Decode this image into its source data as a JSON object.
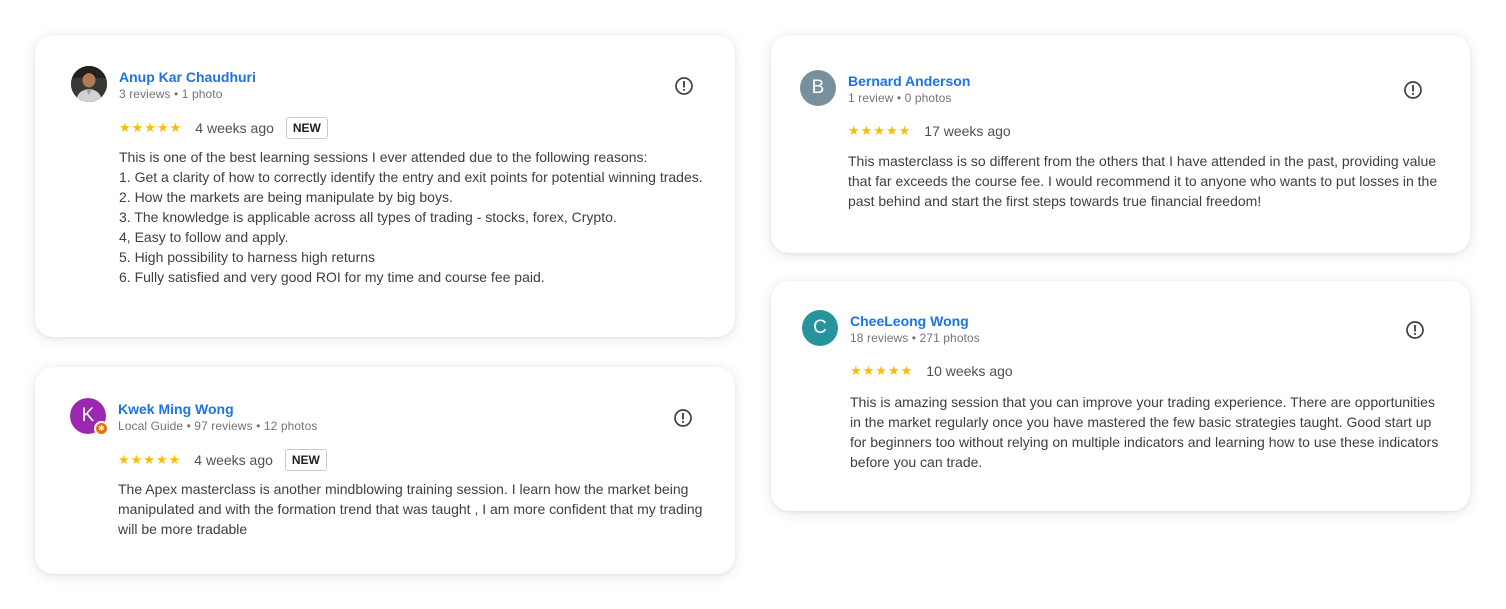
{
  "colors": {
    "name_link": "#1a73e8",
    "star": "#fbbc04",
    "avatar_kwek": "#9c27b0",
    "avatar_bernard": "#78909c",
    "avatar_cheeleong": "#26939d",
    "local_guide_badge": "#e37400"
  },
  "reviews": [
    {
      "author": "Anup Kar Chaudhuri",
      "meta": "3 reviews • 1 photo",
      "avatar_icon": "user-photo",
      "stars": "★★★★★",
      "rating": 5,
      "time_ago": "4 weeks ago",
      "badge": "NEW",
      "text": "This is one of the best learning sessions I ever attended due to the following reasons:\n1. Get a clarity of how to correctly identify the entry and exit points for potential winning trades.\n2. How the markets are being manipulate by big boys.\n3. The knowledge is applicable across all types of trading - stocks, forex, Crypto.\n4, Easy to follow and apply.\n5. High possibility to harness high returns\n6. Fully satisfied and very good ROI for my time and course fee paid.",
      "flag_icon": "report-icon"
    },
    {
      "author": "Kwek Ming Wong",
      "meta": "Local Guide • 97 reviews • 12 photos",
      "avatar_letter": "K",
      "stars": "★★★★★",
      "rating": 5,
      "time_ago": "4 weeks ago",
      "badge": "NEW",
      "text": "The Apex masterclass is another mindblowing training session. I learn how the market being manipulated and with the formation trend that was taught , I am more confident that my trading will be more tradable",
      "flag_icon": "report-icon"
    },
    {
      "author": "Bernard Anderson",
      "meta": "1 review • 0 photos",
      "avatar_letter": "B",
      "stars": "★★★★★",
      "rating": 5,
      "time_ago": "17 weeks ago",
      "text": "This masterclass is so different from the others that I have attended in the past, providing value that far exceeds the course fee. I would recommend it to anyone who wants to put losses in the past behind and start the first steps towards true financial freedom!",
      "flag_icon": "report-icon"
    },
    {
      "author": "CheeLeong Wong",
      "meta": "18 reviews • 271 photos",
      "avatar_letter": "C",
      "stars": "★★★★★",
      "rating": 5,
      "time_ago": "10 weeks ago",
      "text": "This is amazing session that you can improve your trading experience. There are opportunities in the market regularly once you have mastered the few basic strategies taught. Good start up for beginners too without relying on multiple indicators and learning how to use these indicators before you can trade.",
      "flag_icon": "report-icon"
    }
  ]
}
